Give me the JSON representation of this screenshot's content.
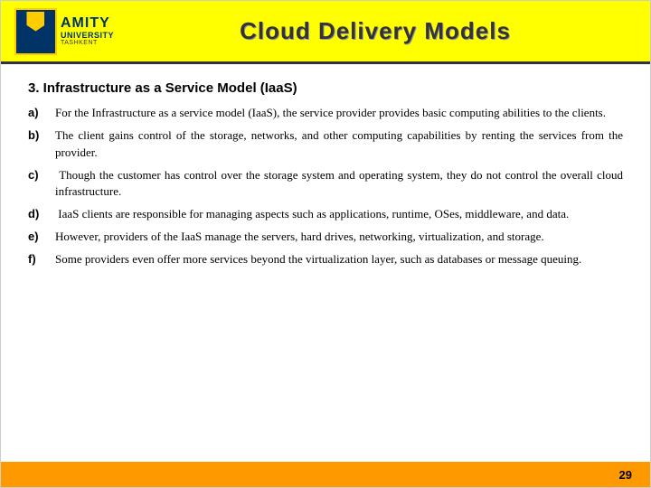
{
  "header": {
    "title": "Cloud Delivery Models",
    "logo_amity": "AMITY",
    "logo_university": "UNIVERSITY",
    "logo_tashkent": "TASHKENT"
  },
  "content": {
    "section_title": "3. Infrastructure as a Service Model (IaaS)",
    "items": [
      {
        "label": "a)",
        "text": "For the Infrastructure as a service model (IaaS), the service provider provides basic computing abilities to the clients."
      },
      {
        "label": "b)",
        "text": "The client gains control of the storage, networks, and other computing capabilities by renting the services from the provider."
      },
      {
        "label": "c)",
        "text": " Though the customer has control over the storage system and operating system, they do not control the overall cloud infrastructure."
      },
      {
        "label": "d)",
        "text": " IaaS clients are responsible for managing aspects such as applications, runtime, OSes, middleware, and data."
      },
      {
        "label": "e)",
        "text": "However, providers of the IaaS manage the servers, hard drives, networking, virtualization, and storage."
      },
      {
        "label": "f)",
        "text": "Some providers even offer more services beyond the virtualization layer, such as databases or message queuing."
      }
    ]
  },
  "footer": {
    "page_number": "29"
  }
}
